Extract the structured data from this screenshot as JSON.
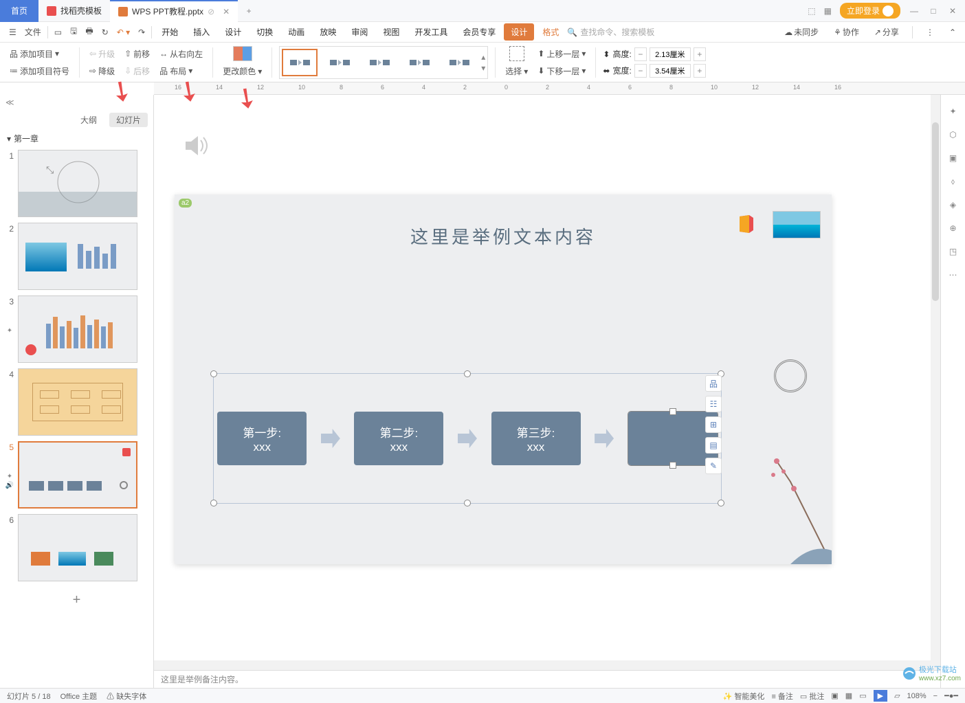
{
  "titlebar": {
    "home": "首页",
    "tab1": "找稻壳模板",
    "tab2": "WPS PPT教程.pptx",
    "login": "立即登录"
  },
  "menubar": {
    "file": "文件",
    "tabs": [
      "开始",
      "插入",
      "设计",
      "切换",
      "动画",
      "放映",
      "审阅",
      "视图",
      "开发工具",
      "会员专享"
    ],
    "design_btn": "设计",
    "format": "格式",
    "search_ph": "查找命令、搜索模板",
    "unsync": "未同步",
    "coop": "协作",
    "share": "分享"
  },
  "ribbon": {
    "add_item": "添加项目",
    "add_bullet": "添加项目符号",
    "promote": "升级",
    "demote": "降级",
    "move_fwd": "前移",
    "move_back": "后移",
    "rtl": "从右向左",
    "layout": "布局",
    "change_color": "更改颜色",
    "select": "选择",
    "move_up": "上移一层",
    "move_down": "下移一层",
    "height_lbl": "高度:",
    "width_lbl": "宽度:",
    "height_val": "2.13厘米",
    "width_val": "3.54厘米"
  },
  "sidepanel": {
    "outline": "大纲",
    "slides": "幻灯片",
    "chapter": "第一章"
  },
  "slide": {
    "badge": "a2",
    "title": "这里是举例文本内容",
    "step1_a": "第一步:",
    "step1_b": "xxx",
    "step2_a": "第二步:",
    "step2_b": "xxx",
    "step3_a": "第三步:",
    "step3_b": "xxx"
  },
  "notes": "这里是举例备注内容。",
  "status": {
    "slide_info": "幻灯片 5 / 18",
    "theme": "Office 主题",
    "font_missing": "缺失字体",
    "smart_beautify": "智能美化",
    "notes_btn": "备注",
    "comments_btn": "批注",
    "zoom": "108%"
  },
  "ruler_marks": [
    "16",
    "14",
    "12",
    "10",
    "8",
    "6",
    "4",
    "2",
    "0",
    "2",
    "4",
    "6",
    "8",
    "10",
    "12",
    "14",
    "16"
  ],
  "watermark": {
    "name": "极光下载站",
    "url": "www.xz7.com"
  }
}
